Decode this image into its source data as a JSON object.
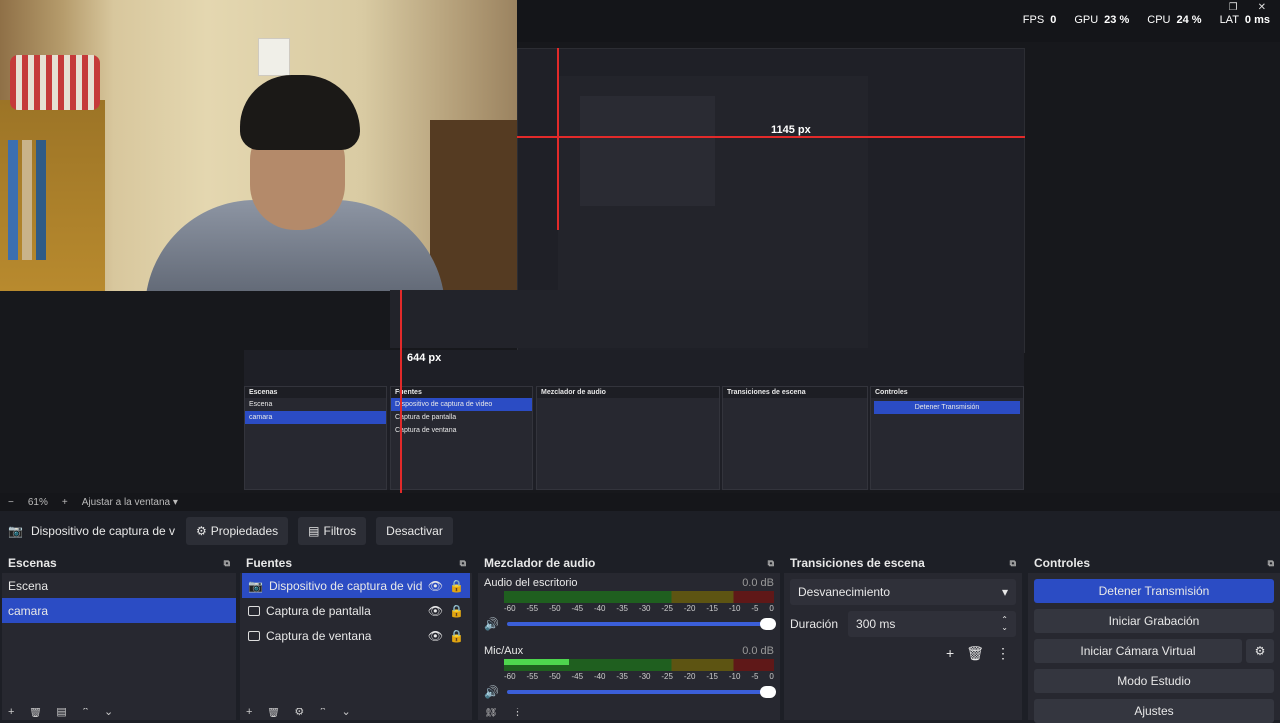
{
  "stats": {
    "fps_label": "FPS",
    "fps_value": "0",
    "gpu_label": "GPU",
    "gpu_value": "23 %",
    "cpu_label": "CPU",
    "cpu_value": "24 %",
    "lat_label": "LAT",
    "lat_value": "0 ms"
  },
  "measure": {
    "h_label": "1145 px",
    "v_label": "644 px"
  },
  "zoom": {
    "minus": "−",
    "value": "61%",
    "plus": "+",
    "fit_label": "Ajustar a la ventana"
  },
  "source_toolbar": {
    "source_name": "Dispositivo de captura de v",
    "properties": "Propiedades",
    "filters": "Filtros",
    "deactivate": "Desactivar"
  },
  "scenes": {
    "title": "Escenas",
    "items": [
      {
        "label": "Escena"
      },
      {
        "label": "camara"
      }
    ]
  },
  "sources": {
    "title": "Fuentes",
    "items": [
      {
        "label": "Dispositivo de captura de video"
      },
      {
        "label": "Captura de pantalla"
      },
      {
        "label": "Captura de ventana"
      }
    ]
  },
  "mixer": {
    "title": "Mezclador de audio",
    "channels": [
      {
        "name": "Audio del escritorio",
        "db": "0.0 dB",
        "level": 0.0
      },
      {
        "name": "Mic/Aux",
        "db": "0.0 dB",
        "level": 0.24
      }
    ],
    "scale": [
      "-60",
      "-55",
      "-50",
      "-45",
      "-40",
      "-35",
      "-30",
      "-25",
      "-20",
      "-15",
      "-10",
      "-5",
      "0"
    ]
  },
  "transitions": {
    "title": "Transiciones de escena",
    "selected": "Desvanecimiento",
    "duration_label": "Duración",
    "duration_value": "300 ms"
  },
  "controls": {
    "title": "Controles",
    "stop_stream": "Detener Transmisión",
    "start_recording": "Iniciar Grabación",
    "virtual_cam": "Iniciar Cámara Virtual",
    "studio_mode": "Modo Estudio",
    "settings": "Ajustes"
  },
  "colors": {
    "accent": "#2b4cc4",
    "panel": "#272830",
    "background": "#1d1f26",
    "measure_line": "#e22a2a"
  }
}
